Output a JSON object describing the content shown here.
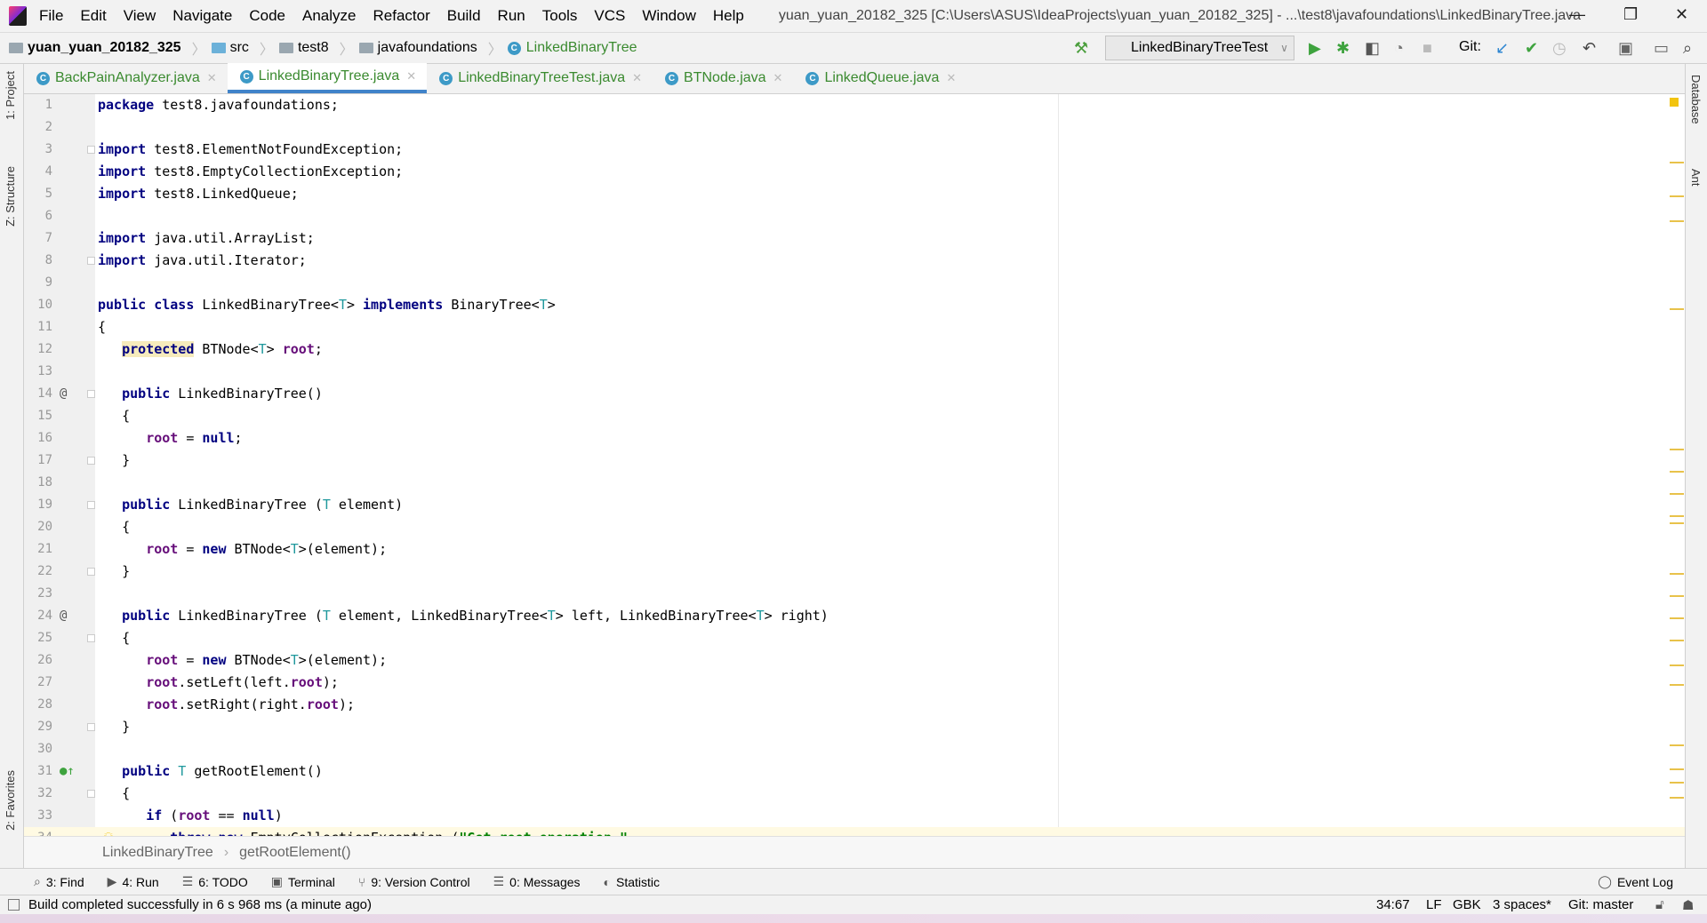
{
  "titlebar": {
    "menus": [
      "File",
      "Edit",
      "View",
      "Navigate",
      "Code",
      "Analyze",
      "Refactor",
      "Build",
      "Run",
      "Tools",
      "VCS",
      "Window",
      "Help"
    ],
    "title": "yuan_yuan_20182_325 [C:\\Users\\ASUS\\IdeaProjects\\yuan_yuan_20182_325] - ...\\test8\\javafoundations\\LinkedBinaryTree.java"
  },
  "navbar": {
    "crumbs": [
      "yuan_yuan_20182_325",
      "src",
      "test8",
      "javafoundations",
      "LinkedBinaryTree"
    ],
    "run_config": "LinkedBinaryTreeTest",
    "git_label": "Git:"
  },
  "tabs": [
    {
      "label": "BackPainAnalyzer.java",
      "active": false
    },
    {
      "label": "LinkedBinaryTree.java",
      "active": true
    },
    {
      "label": "LinkedBinaryTreeTest.java",
      "active": false
    },
    {
      "label": "BTNode.java",
      "active": false
    },
    {
      "label": "LinkedQueue.java",
      "active": false
    }
  ],
  "left_tools": [
    "1: Project",
    "Z: Structure",
    "2: Favorites"
  ],
  "right_tools": [
    "Database",
    "Ant"
  ],
  "editor": {
    "lines": [
      [
        [
          "kw",
          "package"
        ],
        [
          "",
          " test8.javafoundations;"
        ]
      ],
      [],
      [
        [
          "kw",
          "import"
        ],
        [
          "",
          " test8.ElementNotFoundException;"
        ]
      ],
      [
        [
          "kw",
          "import"
        ],
        [
          "",
          " test8.EmptyCollectionException;"
        ]
      ],
      [
        [
          "kw",
          "import"
        ],
        [
          "",
          " test8.LinkedQueue;"
        ]
      ],
      [],
      [
        [
          "kw",
          "import"
        ],
        [
          "",
          " java.util.ArrayList;"
        ]
      ],
      [
        [
          "kw",
          "import"
        ],
        [
          "",
          " java.util.Iterator;"
        ]
      ],
      [],
      [
        [
          "kw",
          "public class"
        ],
        [
          "",
          " LinkedBinaryTree<"
        ],
        [
          "tp",
          "T"
        ],
        [
          "",
          "> "
        ],
        [
          "kw",
          "implements"
        ],
        [
          "",
          " BinaryTree<"
        ],
        [
          "tp",
          "T"
        ],
        [
          "",
          ">"
        ]
      ],
      [
        [
          "",
          "{"
        ]
      ],
      [
        [
          "",
          "   "
        ],
        [
          "kw hl",
          "protected"
        ],
        [
          "",
          " BTNode<"
        ],
        [
          "tp",
          "T"
        ],
        [
          "",
          "> "
        ],
        [
          "fd",
          "root"
        ],
        [
          "",
          ";"
        ]
      ],
      [],
      [
        [
          "",
          "   "
        ],
        [
          "kw",
          "public"
        ],
        [
          "",
          " LinkedBinaryTree()"
        ]
      ],
      [
        [
          "",
          "   {"
        ]
      ],
      [
        [
          "",
          "      "
        ],
        [
          "fd",
          "root"
        ],
        [
          "",
          " = "
        ],
        [
          "kw",
          "null"
        ],
        [
          "",
          ";"
        ]
      ],
      [
        [
          "",
          "   }"
        ]
      ],
      [],
      [
        [
          "",
          "   "
        ],
        [
          "kw",
          "public"
        ],
        [
          "",
          " LinkedBinaryTree ("
        ],
        [
          "tp",
          "T"
        ],
        [
          "",
          " element)"
        ]
      ],
      [
        [
          "",
          "   {"
        ]
      ],
      [
        [
          "",
          "      "
        ],
        [
          "fd",
          "root"
        ],
        [
          "",
          " = "
        ],
        [
          "kw",
          "new"
        ],
        [
          "",
          " BTNode<"
        ],
        [
          "tp",
          "T"
        ],
        [
          "",
          ">(element);"
        ]
      ],
      [
        [
          "",
          "   }"
        ]
      ],
      [],
      [
        [
          "",
          "   "
        ],
        [
          "kw",
          "public"
        ],
        [
          "",
          " LinkedBinaryTree ("
        ],
        [
          "tp",
          "T"
        ],
        [
          "",
          " element, LinkedBinaryTree<"
        ],
        [
          "tp",
          "T"
        ],
        [
          "",
          "> left, LinkedBinaryTree<"
        ],
        [
          "tp",
          "T"
        ],
        [
          "",
          "> right)"
        ]
      ],
      [
        [
          "",
          "   {"
        ]
      ],
      [
        [
          "",
          "      "
        ],
        [
          "fd",
          "root"
        ],
        [
          "",
          " = "
        ],
        [
          "kw",
          "new"
        ],
        [
          "",
          " BTNode<"
        ],
        [
          "tp",
          "T"
        ],
        [
          "",
          ">(element);"
        ]
      ],
      [
        [
          "",
          "      "
        ],
        [
          "fd",
          "root"
        ],
        [
          "",
          ".setLeft(left."
        ],
        [
          "fd",
          "root"
        ],
        [
          "",
          ");"
        ]
      ],
      [
        [
          "",
          "      "
        ],
        [
          "fd",
          "root"
        ],
        [
          "",
          ".setRight(right."
        ],
        [
          "fd",
          "root"
        ],
        [
          "",
          ");"
        ]
      ],
      [
        [
          "",
          "   }"
        ]
      ],
      [],
      [
        [
          "",
          "   "
        ],
        [
          "kw",
          "public"
        ],
        [
          "tp",
          " T"
        ],
        [
          "",
          " getRootElement()"
        ]
      ],
      [
        [
          "",
          "   {"
        ]
      ],
      [
        [
          "",
          "      "
        ],
        [
          "kw",
          "if"
        ],
        [
          "",
          " ("
        ],
        [
          "fd",
          "root"
        ],
        [
          "",
          " == "
        ],
        [
          "kw",
          "null"
        ],
        [
          "",
          ")"
        ]
      ],
      [
        [
          "",
          "         "
        ],
        [
          "kw",
          "throw new"
        ],
        [
          "",
          " EmptyCollectionException ("
        ],
        [
          "st",
          "\"Get root operation \""
        ]
      ]
    ],
    "current_line": 34
  },
  "breadcrumb": [
    "LinkedBinaryTree",
    "getRootElement()"
  ],
  "toolwindows": [
    {
      "icon": "search-icon",
      "label": "3: Find"
    },
    {
      "icon": "run-icon",
      "label": "4: Run"
    },
    {
      "icon": "todo-icon",
      "label": "6: TODO"
    },
    {
      "icon": "terminal-icon",
      "label": "Terminal"
    },
    {
      "icon": "vcs-icon",
      "label": "9: Version Control"
    },
    {
      "icon": "messages-icon",
      "label": "0: Messages"
    },
    {
      "icon": "statistic-icon",
      "label": "Statistic"
    }
  ],
  "event_log": "Event Log",
  "status": {
    "message": "Build completed successfully in 6 s 968 ms (a minute ago)",
    "position": "34:67",
    "line_sep": "LF",
    "encoding": "GBK",
    "indent": "3 spaces*",
    "git": "Git: master"
  }
}
